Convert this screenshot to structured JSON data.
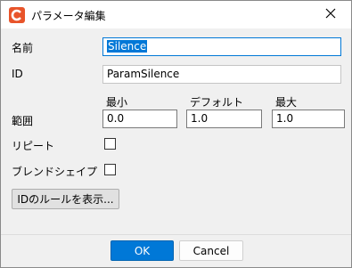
{
  "window": {
    "title": "パラメータ編集",
    "app_icon": "cubism-editor-icon",
    "close_icon": "close-icon"
  },
  "form": {
    "name_label": "名前",
    "name_value": "Silence",
    "id_label": "ID",
    "id_value": "ParamSilence",
    "range_label": "範囲",
    "min_label": "最小",
    "default_label": "デフォルト",
    "max_label": "最大",
    "min_value": "0.0",
    "default_value": "1.0",
    "max_value": "1.0",
    "repeat_label": "リピート",
    "repeat_checked": false,
    "blend_shape_label": "ブレンドシェイプ",
    "blend_shape_checked": false,
    "id_rules_button": "IDのルールを表示..."
  },
  "footer": {
    "ok_label": "OK",
    "cancel_label": "Cancel"
  },
  "colors": {
    "accent": "#0078d7",
    "app_icon": "#e8542a"
  }
}
